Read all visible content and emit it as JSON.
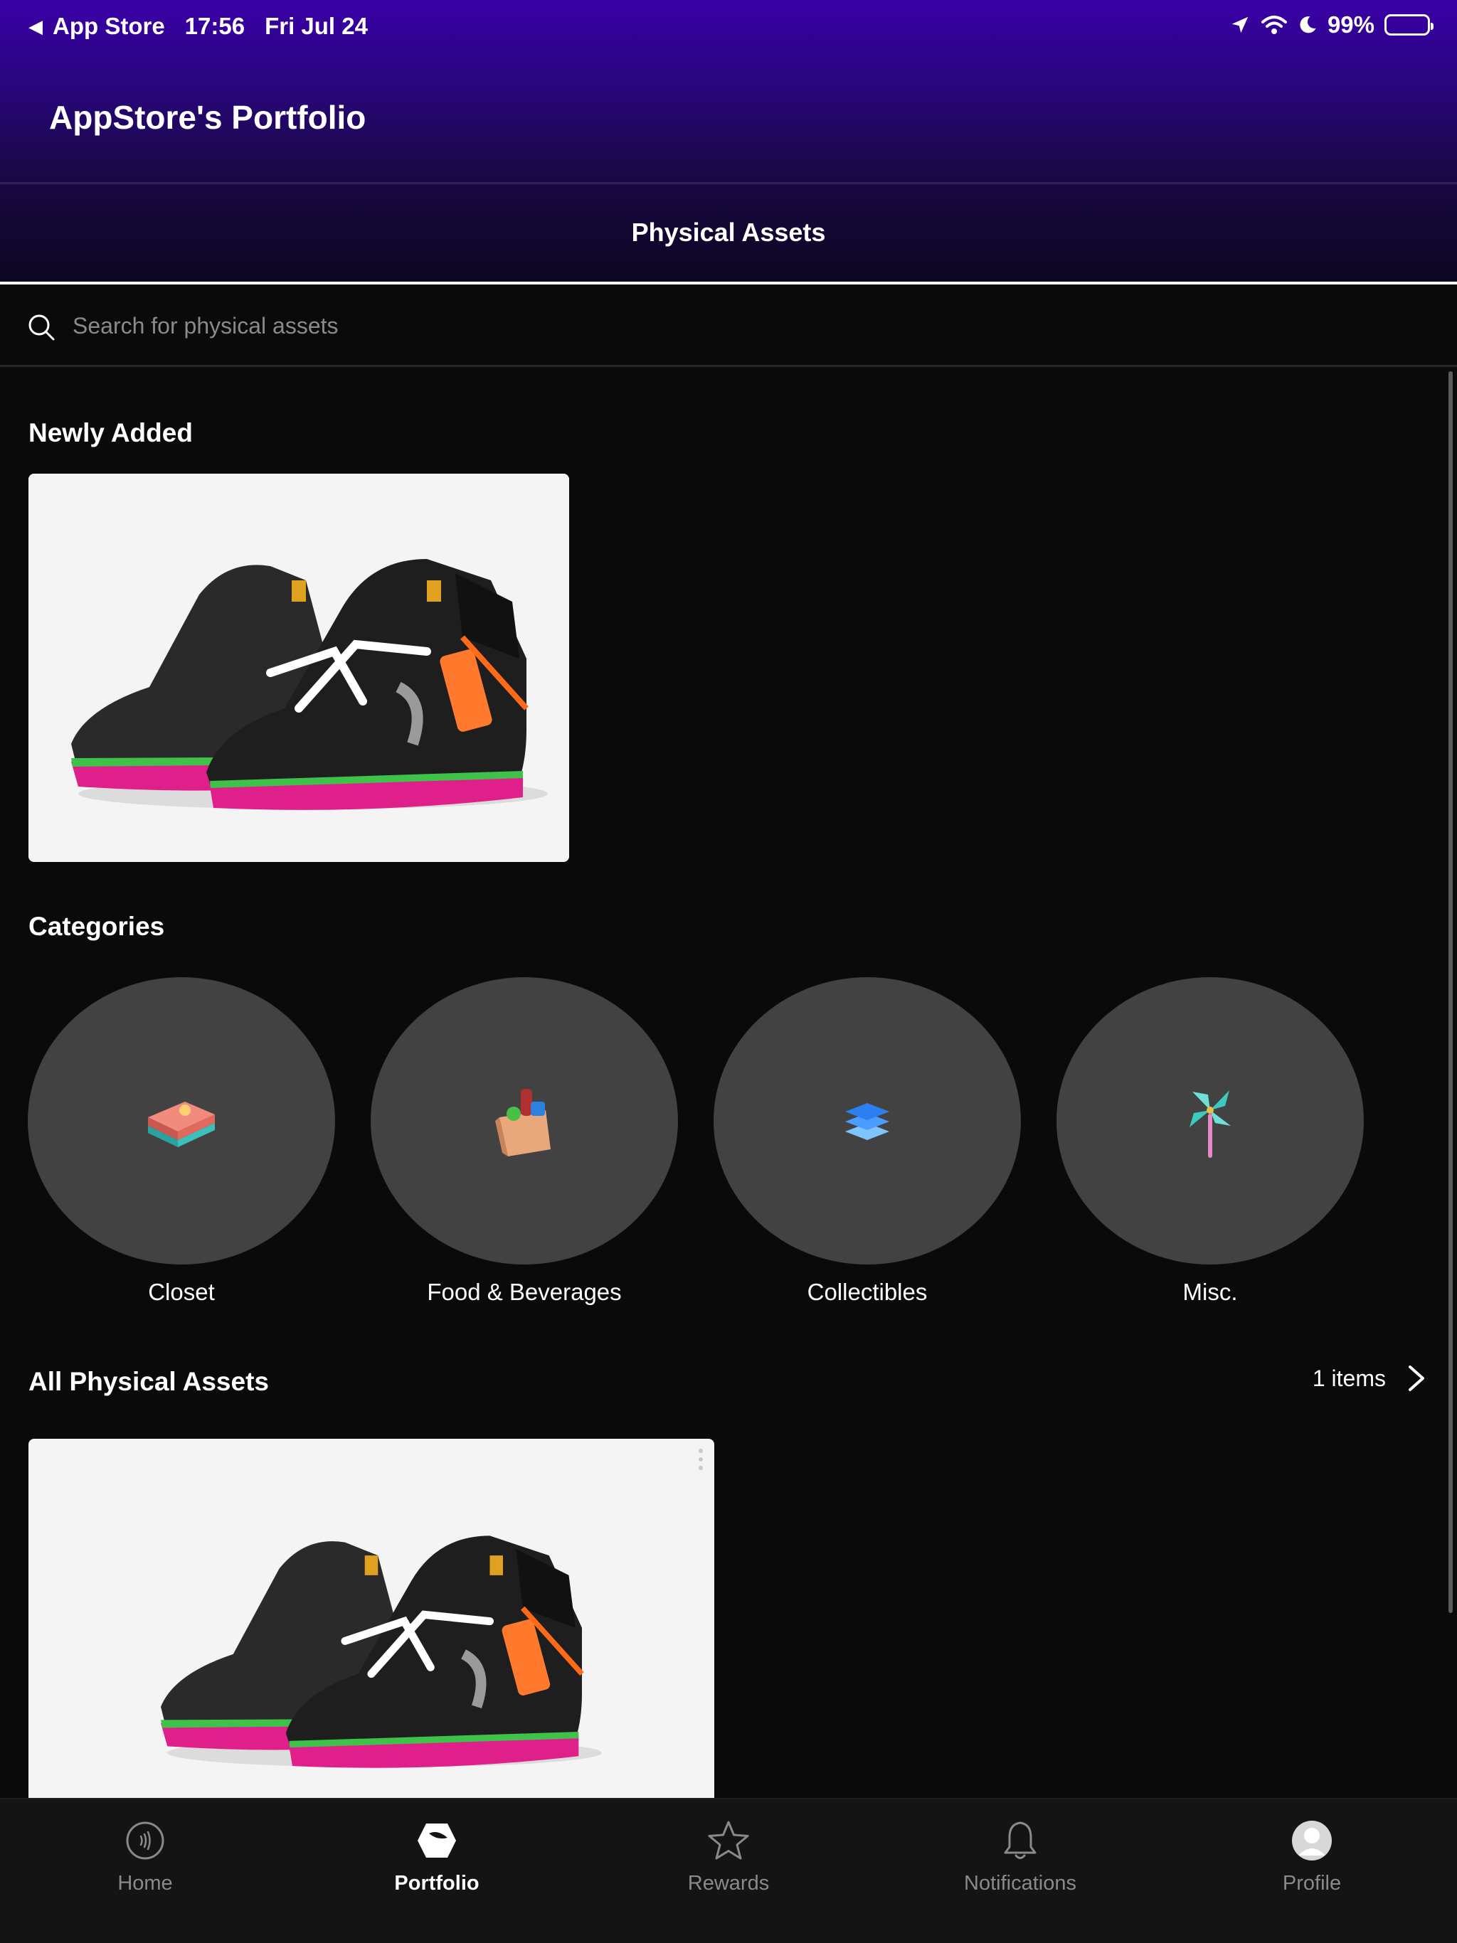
{
  "status_bar": {
    "back_app": "App Store",
    "time": "17:56",
    "date": "Fri Jul 24",
    "battery": "99%",
    "battery_level": 0.99
  },
  "header": {
    "title": "AppStore's Portfolio",
    "active_tab": "Physical Assets"
  },
  "search": {
    "placeholder": "Search for physical assets"
  },
  "newly_added": {
    "title": "Newly Added"
  },
  "categories": {
    "title": "Categories",
    "items": [
      {
        "label": "Closet",
        "icon": "folded-clothes-icon"
      },
      {
        "label": "Food & Beverages",
        "icon": "grocery-bag-icon"
      },
      {
        "label": "Collectibles",
        "icon": "stacked-layers-icon"
      },
      {
        "label": "Misc.",
        "icon": "pinwheel-icon"
      }
    ]
  },
  "all_assets": {
    "title": "All Physical Assets",
    "count_label": "1 items"
  },
  "tabbar": {
    "items": [
      {
        "label": "Home",
        "icon": "contactless-icon",
        "active": false
      },
      {
        "label": "Portfolio",
        "icon": "portfolio-icon",
        "active": true
      },
      {
        "label": "Rewards",
        "icon": "star-icon",
        "active": false
      },
      {
        "label": "Notifications",
        "icon": "bell-icon",
        "active": false
      },
      {
        "label": "Profile",
        "icon": "avatar-icon",
        "active": false
      }
    ]
  },
  "colors": {
    "header_top": "#3a00a8",
    "background": "#0a0a0a",
    "category_circle": "#424242",
    "tabbar": "#141414"
  }
}
